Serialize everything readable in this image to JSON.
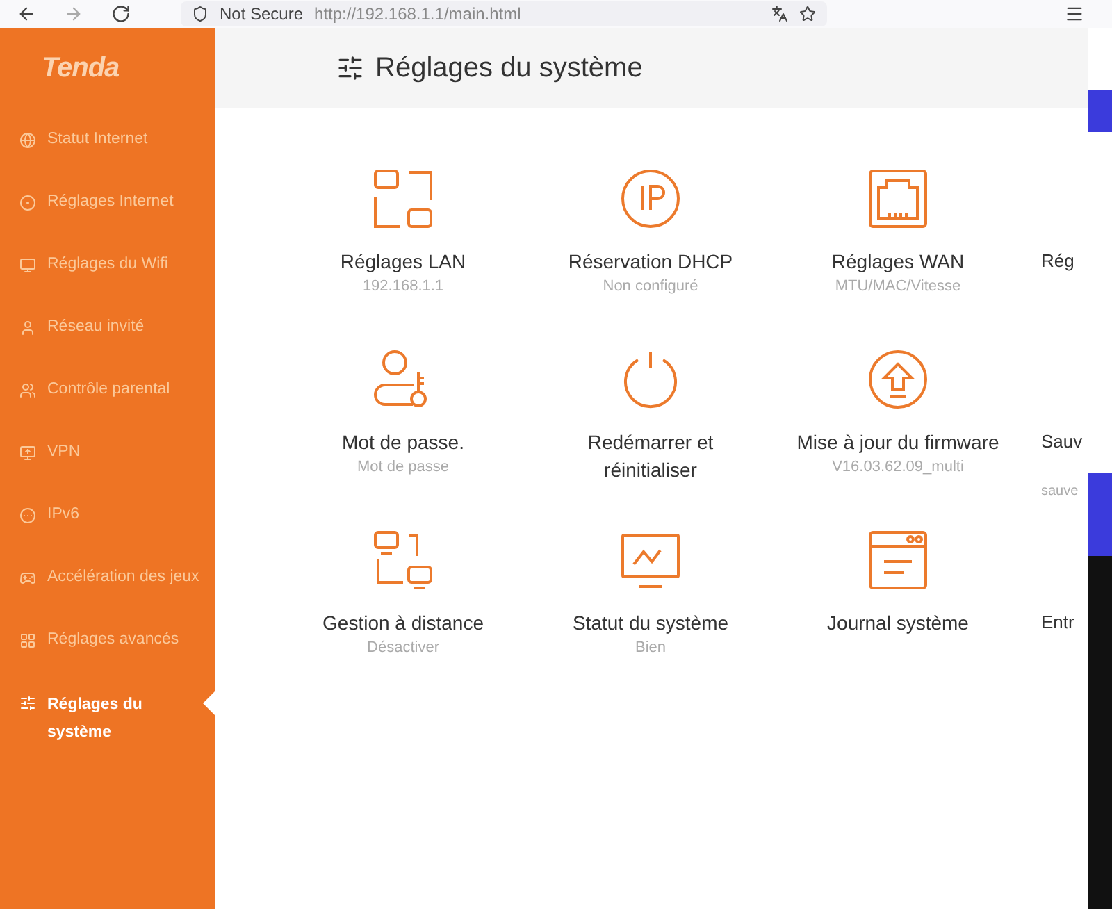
{
  "browser": {
    "security_label": "Not Secure",
    "url": "http://192.168.1.1/main.html"
  },
  "logo": "Tenda",
  "sidebar": {
    "items": [
      {
        "label": "Statut Internet",
        "selected": false
      },
      {
        "label": "Réglages Internet",
        "selected": false
      },
      {
        "label": "Réglages du Wifi",
        "selected": false
      },
      {
        "label": "Réseau invité",
        "selected": false
      },
      {
        "label": "Contrôle parental",
        "selected": false
      },
      {
        "label": "VPN",
        "selected": false
      },
      {
        "label": "IPv6",
        "selected": false
      },
      {
        "label": "Accélération des jeux",
        "selected": false
      },
      {
        "label": "Réglages avancés",
        "selected": false
      },
      {
        "label": "Réglages du système",
        "selected": true
      }
    ]
  },
  "page_title": "Réglages du système",
  "tile_rows": [
    [
      {
        "title": "Réglages LAN",
        "subtitle": "192.168.1.1"
      },
      {
        "title": "Réservation DHCP",
        "subtitle": "Non configuré"
      },
      {
        "title": "Réglages WAN",
        "subtitle": "MTU/MAC/Vitesse"
      },
      {
        "title": "Rég"
      }
    ],
    [
      {
        "title": "Mot de passe.",
        "subtitle": "Mot de passe"
      },
      {
        "title": "Redémarrer et réinitialiser"
      },
      {
        "title": "Mise à jour du firmware",
        "subtitle": "V16.03.62.09_multi"
      },
      {
        "title": "Sauv",
        "subtitle": "sauve"
      }
    ],
    [
      {
        "title": "Gestion à distance",
        "subtitle": "Désactiver"
      },
      {
        "title": "Statut du système",
        "subtitle": "Bien"
      },
      {
        "title": "Journal système"
      },
      {
        "title": "Entr"
      }
    ]
  ]
}
